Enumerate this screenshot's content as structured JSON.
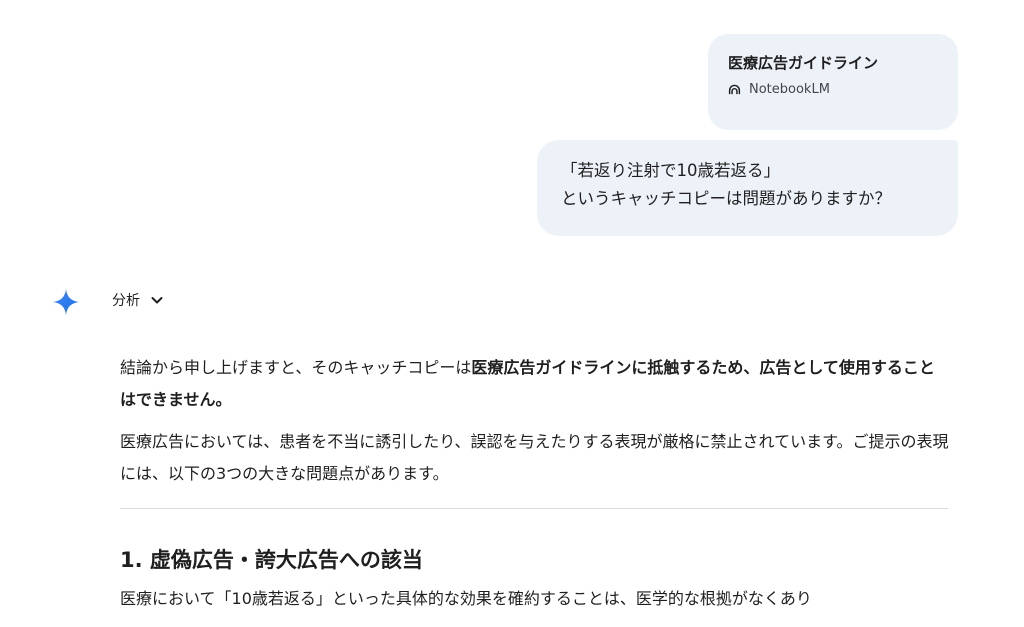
{
  "source": {
    "title": "医療広告ガイドライン",
    "origin": "NotebookLM",
    "icon": "notebooklm-icon"
  },
  "user_message": {
    "line1": "「若返り注射で10歳若返る」",
    "line2": "というキャッチコピーは問題がありますか？"
  },
  "response": {
    "icon": "gemini-sparkle-icon",
    "analysis_label": "分析",
    "p1_normal": "結論から申し上げますと、そのキャッチコピーは",
    "p1_bold": "医療広告ガイドラインに抵触するため、広告として使用することはできません。",
    "p2": "医療広告においては、患者を不当に誘引したり、誤認を与えたりする表現が厳格に禁止されています。ご提示の表現には、以下の3つの大きな問題点があります。",
    "section1_heading": "1. 虚偽広告・誇大広告への該当",
    "section1_text": "医療において「10歳若返る」といった具体的な効果を確約することは、医学的な根拠がなくあり"
  },
  "colors": {
    "bubble_bg": "#edf2f9",
    "sparkle": "#1a73e8",
    "text": "#1f1f1f",
    "divider": "#dadce0"
  }
}
